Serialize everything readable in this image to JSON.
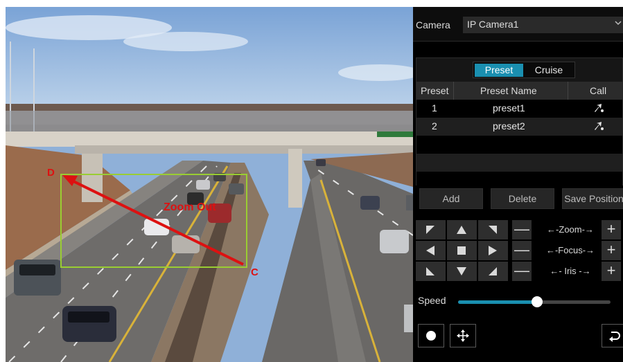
{
  "overlay": {
    "corner_start": "D",
    "corner_end": "C",
    "action_label": "Zoom Out",
    "box_color": "#9acd32",
    "arrow_color": "#dd1111"
  },
  "panel": {
    "camera_label": "Camera",
    "camera_value": "IP Camera1",
    "caret_icon": "chevron-down-icon",
    "tabs": [
      {
        "label": "Preset",
        "active": true
      },
      {
        "label": "Cruise",
        "active": false
      }
    ],
    "table": {
      "columns": [
        "Preset",
        "Preset Name",
        "Call"
      ],
      "rows": [
        {
          "no": "1",
          "name": "preset1",
          "call_icon": "call-preset-icon"
        },
        {
          "no": "2",
          "name": "preset2",
          "call_icon": "call-preset-icon"
        }
      ]
    },
    "buttons": {
      "add": "Add",
      "delete": "Delete",
      "save_position": "Save Position"
    },
    "ptz": {
      "zoom_label": "←-Zoom-→",
      "focus_label": "←-Focus-→",
      "iris_label": "←-  Iris  -→",
      "minus": "—",
      "plus": "+"
    },
    "speed": {
      "label": "Speed",
      "level": 0.52
    },
    "bottom_icons": [
      "record-icon",
      "move-icon",
      "return-icon"
    ],
    "accent_color": "#1a8fb0"
  }
}
